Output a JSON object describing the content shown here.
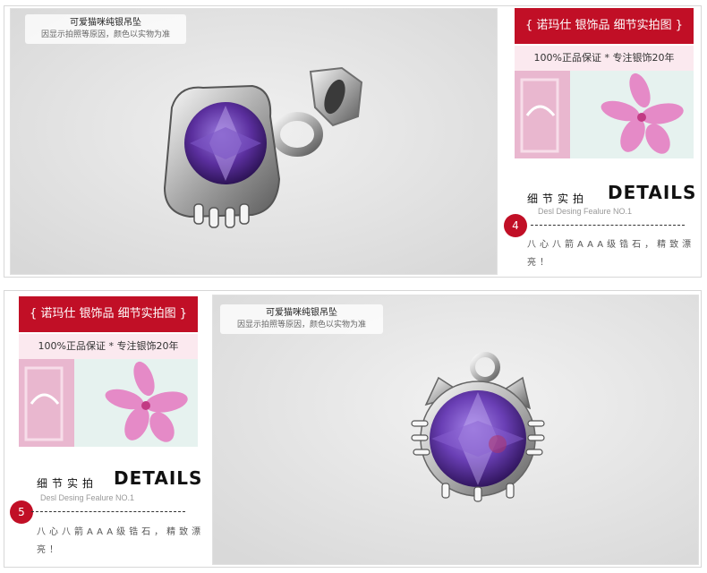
{
  "sections": [
    {
      "caption": {
        "title": "可爱猫咪纯银吊坠",
        "subtitle": "因显示拍照等原因，颜色以实物为准"
      },
      "panel": {
        "banner": "{ 诺玛仕 银饰品 细节实拍图 }",
        "guarantee": "100%正品保证 * 专注银饰20年",
        "details_zh": "细节实拍",
        "details_en": "DETAILS",
        "subline": "Desl Desing Fealure NO.1",
        "number": "4",
        "description": "八心八箭AAA级锆石，精致漂亮！"
      }
    },
    {
      "caption": {
        "title": "可爱猫咪纯银吊坠",
        "subtitle": "因显示拍照等原因，颜色以实物为准"
      },
      "panel": {
        "banner": "{ 诺玛仕 银饰品 细节实拍图 }",
        "guarantee": "100%正品保证 * 专注银饰20年",
        "details_zh": "细节实拍",
        "details_en": "DETAILS",
        "subline": "Desl Desing Fealure NO.1",
        "number": "5",
        "description": "八心八箭AAA级锆石，精致漂亮！"
      }
    }
  ],
  "colors": {
    "accent_red": "#c10f26",
    "gem_purple": "#6a3fb5",
    "banner_pink": "#fbe9ef",
    "photo_bg": "#e6e6e6"
  },
  "icons": [
    "cat-pendant-photo",
    "flower-thumbnail",
    "chair-thumbnail"
  ]
}
